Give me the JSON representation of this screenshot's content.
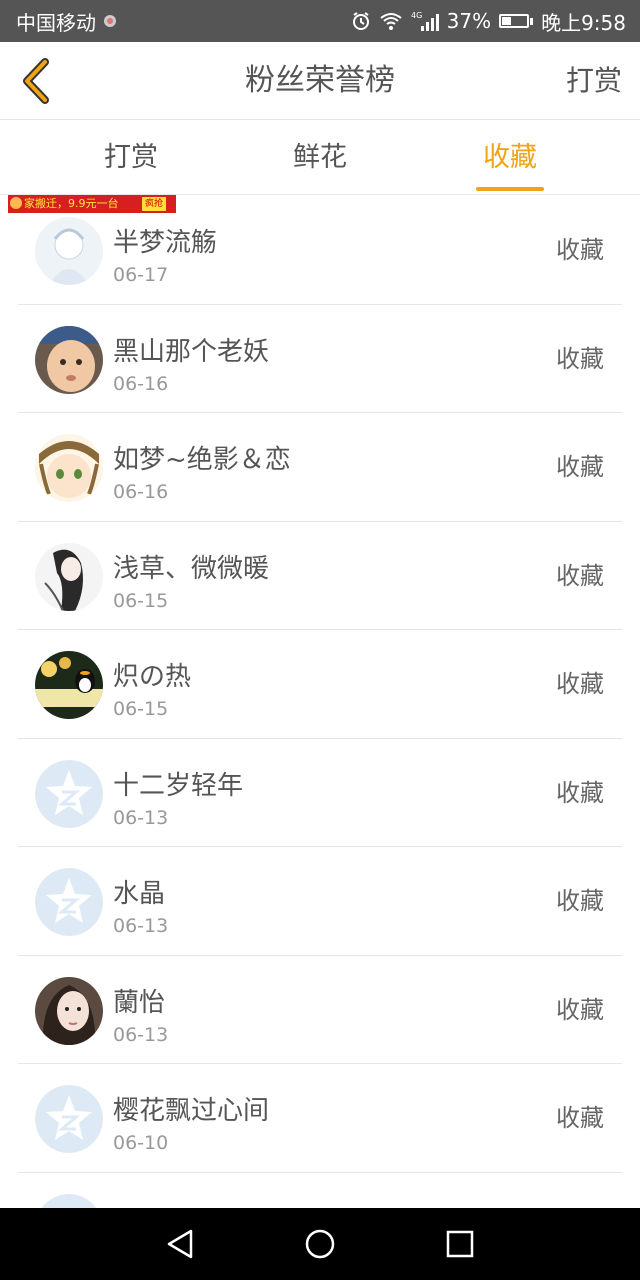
{
  "status_bar": {
    "carrier": "中国移动",
    "network": "4G",
    "battery": "37%",
    "time": "晚上9:58"
  },
  "header": {
    "title": "粉丝荣誉榜",
    "action_label": "打赏"
  },
  "tabs": [
    {
      "label": "打赏",
      "active": false
    },
    {
      "label": "鲜花",
      "active": false
    },
    {
      "label": "收藏",
      "active": true
    }
  ],
  "ad": {
    "text": "家搬迁，9.9元一台",
    "button": "疯抢"
  },
  "colors": {
    "accent": "#f0a314",
    "status_bar_bg": "#555555",
    "text_primary": "#555555",
    "text_secondary": "#999999",
    "default_avatar": "#dde9f5"
  },
  "list": [
    {
      "name": "半梦流觞",
      "date": "06-17",
      "action": "收藏",
      "avatar": "anime-white"
    },
    {
      "name": "黑山那个老妖",
      "date": "06-16",
      "action": "收藏",
      "avatar": "baby-photo"
    },
    {
      "name": "如梦~绝影＆恋",
      "date": "06-16",
      "action": "收藏",
      "avatar": "anime-girl"
    },
    {
      "name": "浅草、微微暖",
      "date": "06-15",
      "action": "收藏",
      "avatar": "ink-girl"
    },
    {
      "name": "炽の热",
      "date": "06-15",
      "action": "收藏",
      "avatar": "qq-penguin"
    },
    {
      "name": "十二岁轻年",
      "date": "06-13",
      "action": "收藏",
      "avatar": "default-star"
    },
    {
      "name": "水晶",
      "date": "06-13",
      "action": "收藏",
      "avatar": "default-star"
    },
    {
      "name": "蘭怡",
      "date": "06-13",
      "action": "收藏",
      "avatar": "woman-photo"
    },
    {
      "name": "樱花飘过心间",
      "date": "06-10",
      "action": "收藏",
      "avatar": "default-star"
    }
  ]
}
